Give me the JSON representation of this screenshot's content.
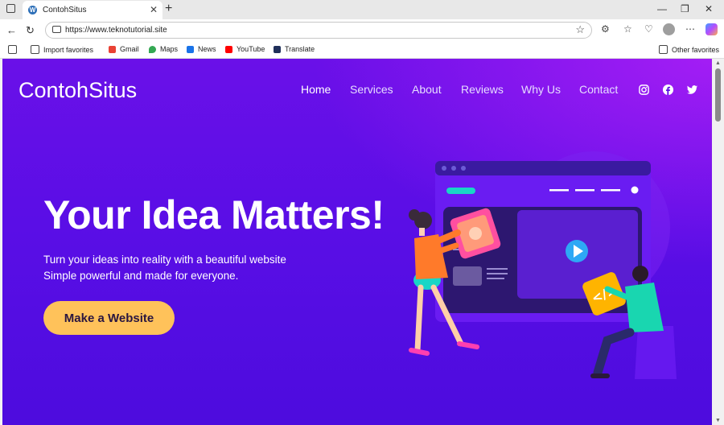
{
  "browser": {
    "tab_title": "ContohSitus",
    "tab_favicon": "wordpress-icon",
    "url": "https://www.teknotutorial.site",
    "bookmarks": [
      {
        "label": "Import favorites",
        "icon": "import-icon"
      },
      {
        "label": "Gmail",
        "icon": "gmail-icon"
      },
      {
        "label": "Maps",
        "icon": "maps-icon"
      },
      {
        "label": "News",
        "icon": "news-icon"
      },
      {
        "label": "YouTube",
        "icon": "youtube-icon"
      },
      {
        "label": "Translate",
        "icon": "translate-icon"
      }
    ],
    "other_favorites": "Other favorites"
  },
  "site": {
    "logo": "ContohSitus",
    "nav": [
      "Home",
      "Services",
      "About",
      "Reviews",
      "Why Us",
      "Contact"
    ],
    "active_nav": "Home",
    "social_icons": [
      "instagram-icon",
      "facebook-icon",
      "twitter-icon"
    ],
    "hero_title": "Your Idea Matters!",
    "hero_line1": "Turn your ideas into reality with a beautiful website",
    "hero_line2": "Simple powerful and made for everyone.",
    "cta": "Make a Website"
  },
  "colors": {
    "gradient_top": "#6a10e8",
    "gradient_bottom": "#4d0cde",
    "cta_bg": "#ffc25a",
    "accent_pink": "#ff4fa0",
    "accent_cyan": "#19d6c6"
  }
}
